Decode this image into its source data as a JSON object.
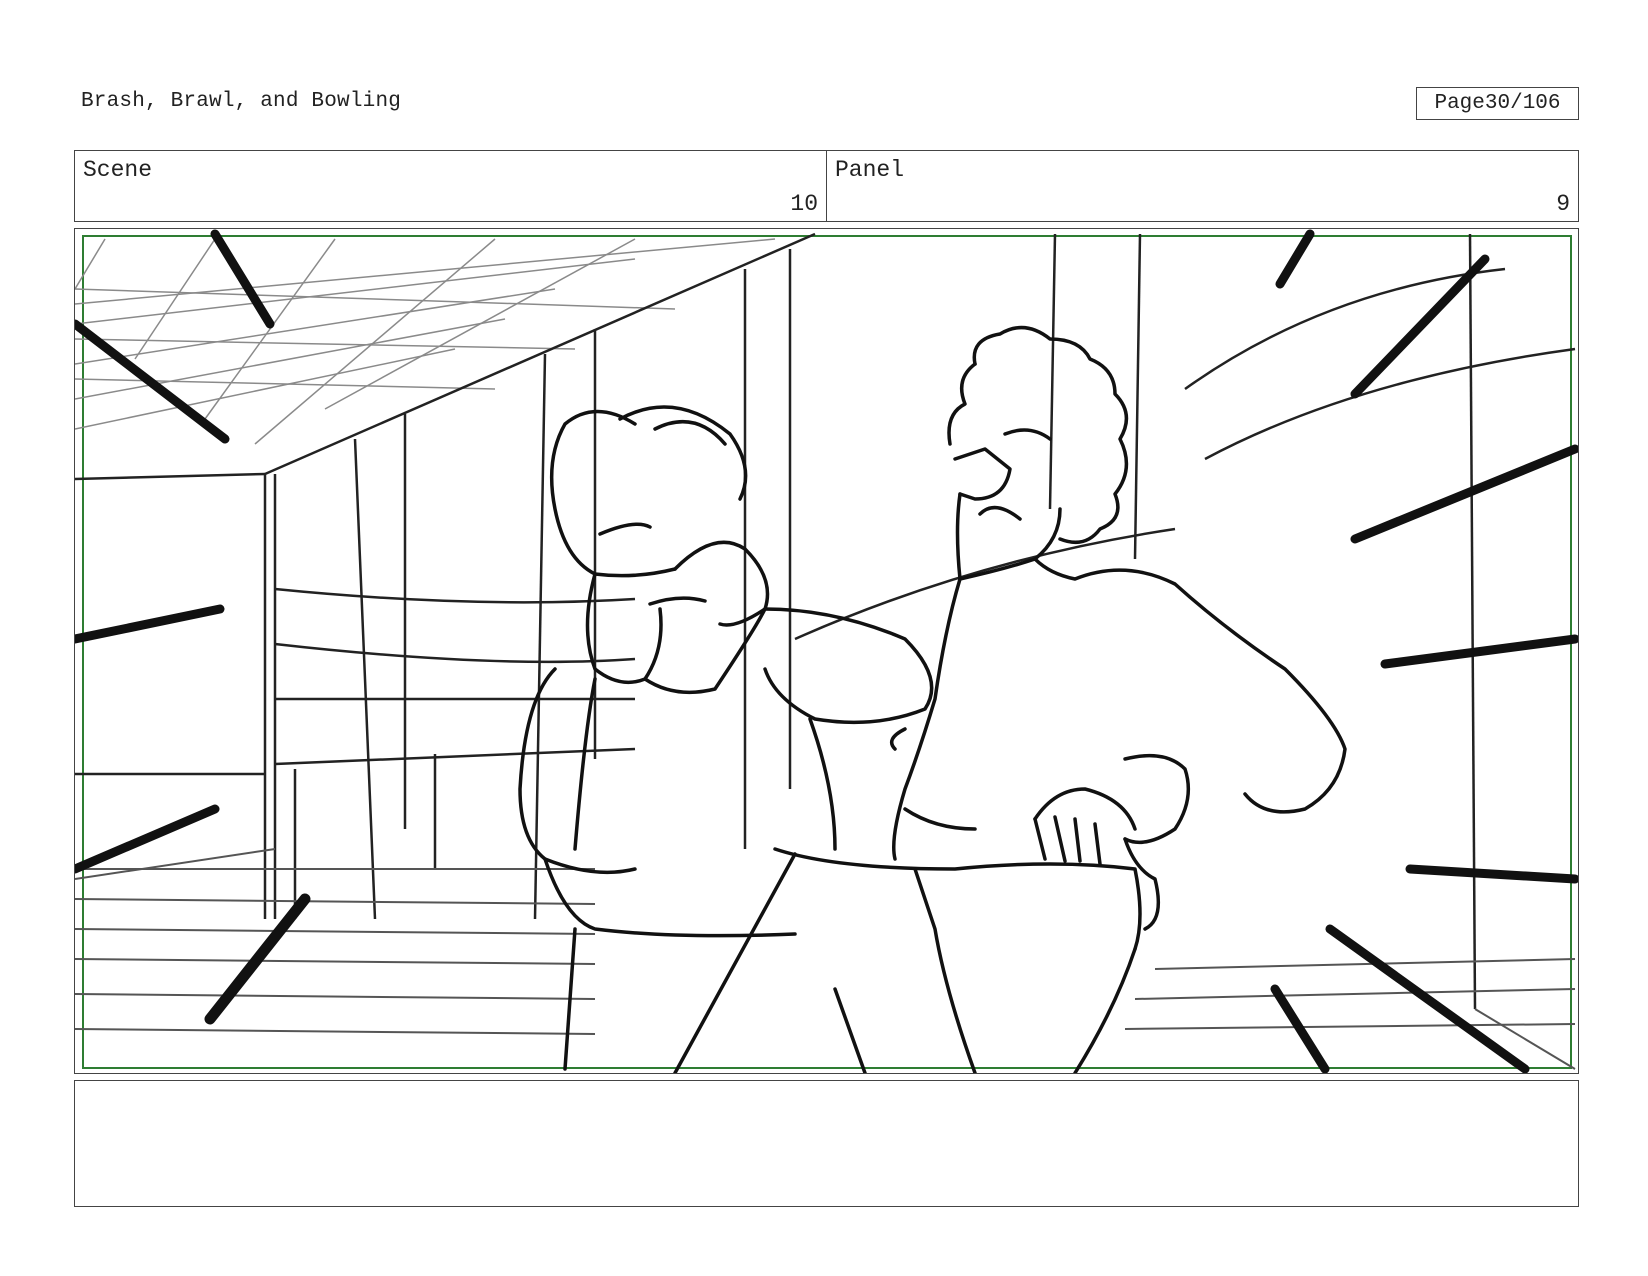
{
  "header": {
    "title": "Brash, Brawl, and Bowling",
    "page_label": "Page",
    "page_number": "30/106"
  },
  "info": {
    "scene_label": "Scene",
    "scene_value": "10",
    "panel_label": "Panel",
    "panel_value": "9"
  },
  "panel": {
    "frame_color": "#2e7d32",
    "description_visible": false
  },
  "notes": {
    "text": ""
  }
}
